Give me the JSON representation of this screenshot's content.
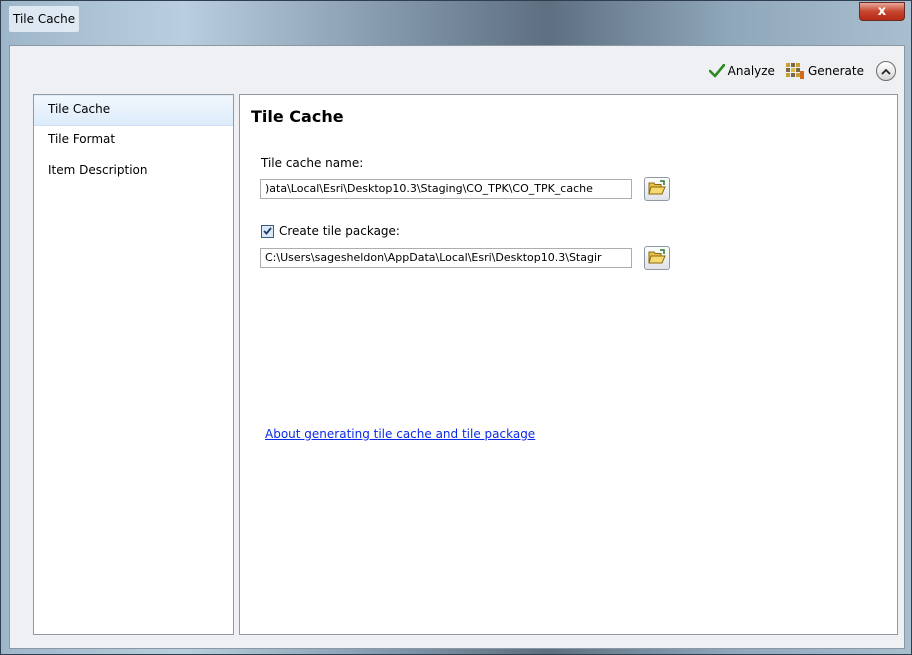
{
  "window": {
    "title": "Tile Cache",
    "close_label": "x"
  },
  "toolbar": {
    "analyze_label": "Analyze",
    "generate_label": "Generate"
  },
  "sidebar": {
    "items": [
      {
        "label": "Tile Cache",
        "selected": true
      },
      {
        "label": "Tile Format",
        "selected": false
      },
      {
        "label": "Item Description",
        "selected": false
      }
    ]
  },
  "main": {
    "title": "Tile Cache",
    "tile_cache_name_label": "Tile cache name:",
    "tile_cache_name_value": ")ata\\Local\\Esri\\Desktop10.3\\Staging\\CO_TPK\\CO_TPK_cache",
    "create_package_label": "Create tile package:",
    "create_package_checked": true,
    "package_path_value": "C:\\Users\\sagesheldon\\AppData\\Local\\Esri\\Desktop10.3\\Stagir",
    "help_link": "About generating tile cache and tile package"
  },
  "colors": {
    "link": "#0b2be6",
    "selection": "#ddecfb",
    "close": "#c7452f",
    "analyze_check": "#2e8b1f"
  },
  "icons": [
    "check-icon",
    "tile-grid-icon",
    "chevron-up-icon",
    "folder-open-icon",
    "checkmark-icon"
  ]
}
